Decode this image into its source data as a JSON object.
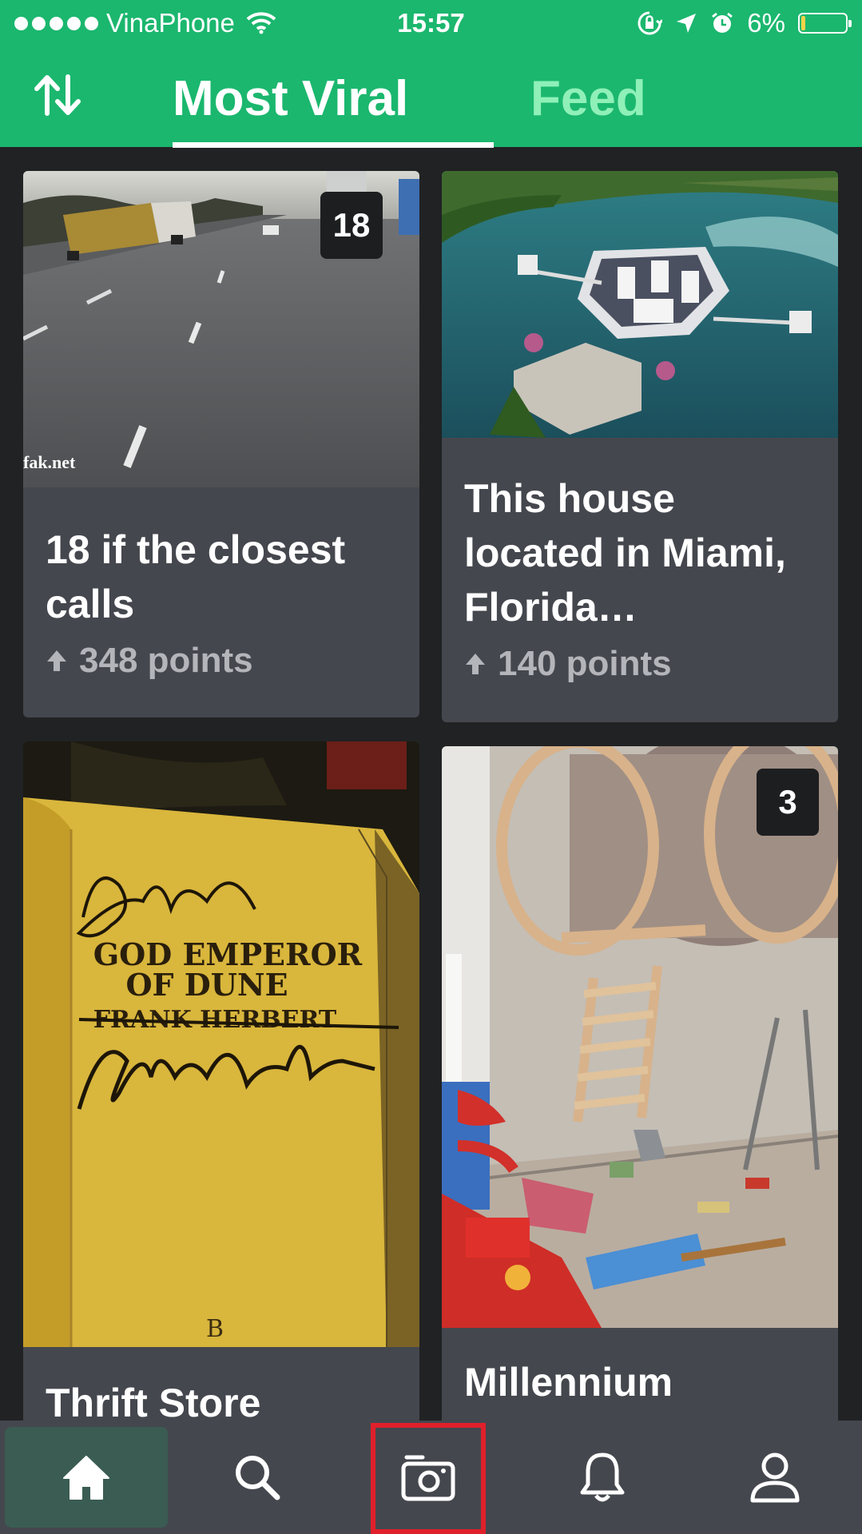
{
  "status_bar": {
    "carrier": "VinaPhone",
    "time": "15:57",
    "battery": "6%",
    "battery_level": 0.06
  },
  "header": {
    "tabs": [
      {
        "label": "Most Viral",
        "active": true
      },
      {
        "label": "Feed",
        "active": false
      }
    ],
    "colors": {
      "brand": "#1bb76e",
      "inactive_tab": "#8ff0b8"
    }
  },
  "cards": [
    {
      "title": "18 if the closest calls",
      "points": "348 points",
      "badge": "18",
      "watermark": "fak.net"
    },
    {
      "title": "This house located in Miami, Florida…",
      "points": "140 points"
    },
    {
      "title": "Thrift Store",
      "book_text": [
        "GOD EMPEROR",
        "OF DUNE",
        "FRANK HERBERT"
      ]
    },
    {
      "title": "Millennium",
      "badge": "3"
    }
  ],
  "bottom_nav": {
    "items": [
      "home-icon",
      "search-icon",
      "camera-icon",
      "bell-icon",
      "user-icon"
    ],
    "active": "home-icon",
    "highlight_color": "#e0202b"
  }
}
